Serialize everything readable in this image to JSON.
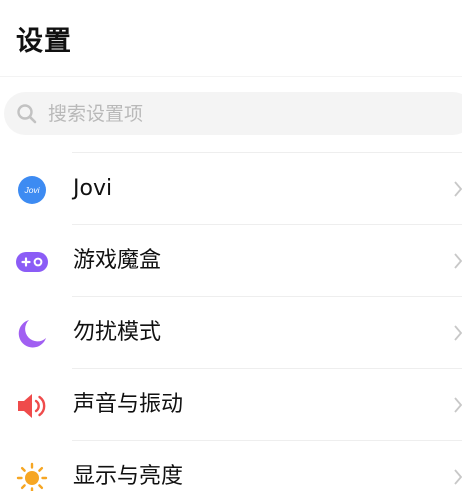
{
  "header": {
    "title": "设置"
  },
  "search": {
    "placeholder": "搜索设置项",
    "value": ""
  },
  "settings_items": [
    {
      "label": "Jovi",
      "icon": "jovi-icon",
      "icon_text": "Jovi",
      "color": "#3d8bf2"
    },
    {
      "label": "游戏魔盒",
      "icon": "game-box-icon",
      "color": "#8b5cf6"
    },
    {
      "label": "勿扰模式",
      "icon": "moon-icon",
      "color": "#a15ff2"
    },
    {
      "label": "声音与振动",
      "icon": "speaker-icon",
      "color": "#ef4b4b"
    },
    {
      "label": "显示与亮度",
      "icon": "sun-icon",
      "color": "#f6a623"
    }
  ]
}
